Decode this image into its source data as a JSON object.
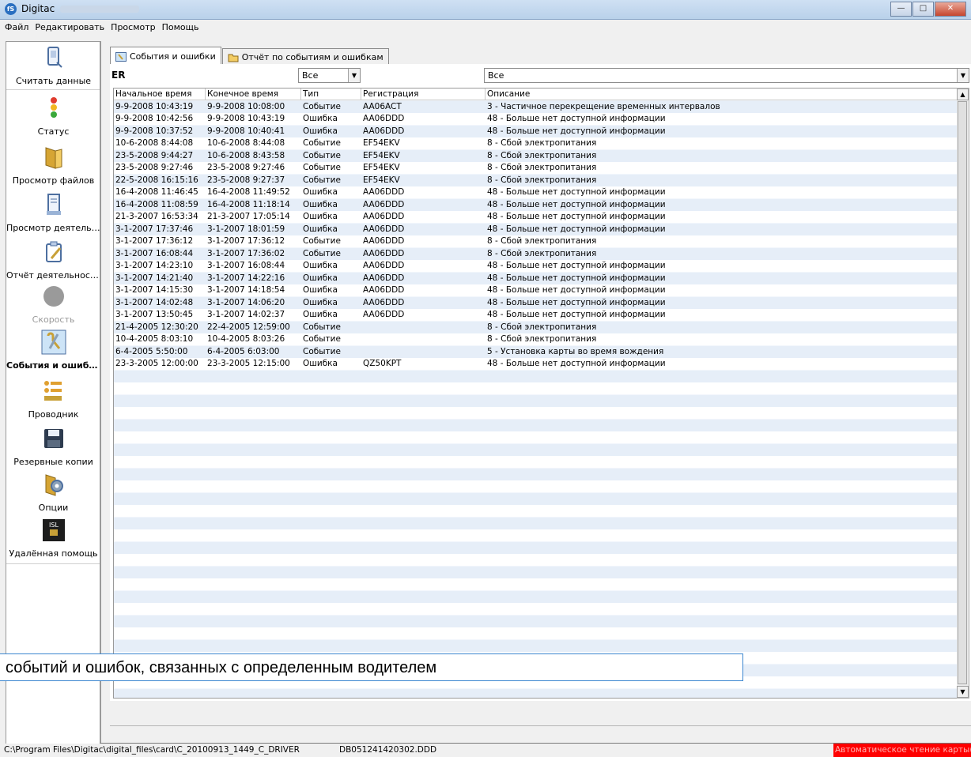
{
  "window": {
    "title": "Digitac"
  },
  "menu": [
    "Файл",
    "Редактировать",
    "Просмотр",
    "Помощь"
  ],
  "sidebar": [
    {
      "label": "Считать данные",
      "icon": "card-reader-icon"
    },
    {
      "label": "Статус",
      "icon": "traffic-light-icon"
    },
    {
      "label": "Просмотр файлов",
      "icon": "folder-icon"
    },
    {
      "label": "Просмотр деятельн...",
      "icon": "document-icon"
    },
    {
      "label": "Отчёт деятельности",
      "icon": "report-icon"
    },
    {
      "label": "Скорость",
      "icon": "speed-icon"
    },
    {
      "label": "События и ошибки",
      "icon": "events-icon"
    },
    {
      "label": "Проводник",
      "icon": "explorer-icon"
    },
    {
      "label": "Резервные копии",
      "icon": "floppy-icon"
    },
    {
      "label": "Опции",
      "icon": "options-icon"
    },
    {
      "label": "Удалённая помощь",
      "icon": "remote-help-icon"
    }
  ],
  "tabs": [
    {
      "label": "События и ошибки",
      "active": true
    },
    {
      "label": "Отчёт по событиям и ошибкам",
      "active": false
    }
  ],
  "filter": {
    "er_label": "ER",
    "type_value": "Все",
    "description_value": "Все"
  },
  "table": {
    "columns": [
      "Начальное время",
      "Конечное время",
      "Тип",
      "Регистрация",
      "Описание"
    ],
    "rows": [
      [
        "9-9-2008 10:43:19",
        "9-9-2008 10:08:00",
        "Событие",
        "AA06ACT",
        "3 - Частичное перекрещение временных интервалов"
      ],
      [
        "9-9-2008 10:42:56",
        "9-9-2008 10:43:19",
        "Ошибка",
        "AA06DDD",
        "48 - Больше нет доступной информации"
      ],
      [
        "9-9-2008 10:37:52",
        "9-9-2008 10:40:41",
        "Ошибка",
        "AA06DDD",
        "48 - Больше нет доступной информации"
      ],
      [
        "10-6-2008 8:44:08",
        "10-6-2008 8:44:08",
        "Событие",
        "EF54EKV",
        "8 - Сбой электропитания"
      ],
      [
        "23-5-2008 9:44:27",
        "10-6-2008 8:43:58",
        "Событие",
        "EF54EKV",
        "8 - Сбой электропитания"
      ],
      [
        "23-5-2008 9:27:46",
        "23-5-2008 9:27:46",
        "Событие",
        "EF54EKV",
        "8 - Сбой электропитания"
      ],
      [
        "22-5-2008 16:15:16",
        "23-5-2008 9:27:37",
        "Событие",
        "EF54EKV",
        "8 - Сбой электропитания"
      ],
      [
        "16-4-2008 11:46:45",
        "16-4-2008 11:49:52",
        "Ошибка",
        "AA06DDD",
        "48 - Больше нет доступной информации"
      ],
      [
        "16-4-2008 11:08:59",
        "16-4-2008 11:18:14",
        "Ошибка",
        "AA06DDD",
        "48 - Больше нет доступной информации"
      ],
      [
        "21-3-2007 16:53:34",
        "21-3-2007 17:05:14",
        "Ошибка",
        "AA06DDD",
        "48 - Больше нет доступной информации"
      ],
      [
        "3-1-2007 17:37:46",
        "3-1-2007 18:01:59",
        "Ошибка",
        "AA06DDD",
        "48 - Больше нет доступной информации"
      ],
      [
        "3-1-2007 17:36:12",
        "3-1-2007 17:36:12",
        "Событие",
        "AA06DDD",
        "8 - Сбой электропитания"
      ],
      [
        "3-1-2007 16:08:44",
        "3-1-2007 17:36:02",
        "Событие",
        "AA06DDD",
        "8 - Сбой электропитания"
      ],
      [
        "3-1-2007 14:23:10",
        "3-1-2007 16:08:44",
        "Ошибка",
        "AA06DDD",
        "48 - Больше нет доступной информации"
      ],
      [
        "3-1-2007 14:21:40",
        "3-1-2007 14:22:16",
        "Ошибка",
        "AA06DDD",
        "48 - Больше нет доступной информации"
      ],
      [
        "3-1-2007 14:15:30",
        "3-1-2007 14:18:54",
        "Ошибка",
        "AA06DDD",
        "48 - Больше нет доступной информации"
      ],
      [
        "3-1-2007 14:02:48",
        "3-1-2007 14:06:20",
        "Ошибка",
        "AA06DDD",
        "48 - Больше нет доступной информации"
      ],
      [
        "3-1-2007 13:50:45",
        "3-1-2007 14:02:37",
        "Ошибка",
        "AA06DDD",
        "48 - Больше нет доступной информации"
      ],
      [
        "21-4-2005 12:30:20",
        "22-4-2005 12:59:00",
        "Событие",
        "",
        "8 - Сбой электропитания"
      ],
      [
        "10-4-2005 8:03:10",
        "10-4-2005 8:03:26",
        "Событие",
        "",
        "8 - Сбой электропитания"
      ],
      [
        "6-4-2005 5:50:00",
        "6-4-2005 6:03:00",
        "Событие",
        "",
        "5 - Установка карты во время вождения"
      ],
      [
        "23-3-2005 12:00:00",
        "23-3-2005 12:15:00",
        "Ошибка",
        "QZ50KPT",
        "48 - Больше нет доступной информации"
      ]
    ]
  },
  "status": {
    "path": "C:\\Program Files\\Digitac\\digital_files\\card\\C_20100913_1449_C_DRIVER",
    "file": "DB051241420302.DDD",
    "auto_read": "Автоматическое чтение карты(Вы"
  },
  "callout": "событий и ошибок, связанных с определенным водителем",
  "colors": {
    "status_alert": "#ff0000",
    "row_alt": "#e6eef8",
    "callout_border": "#3b86d0"
  }
}
